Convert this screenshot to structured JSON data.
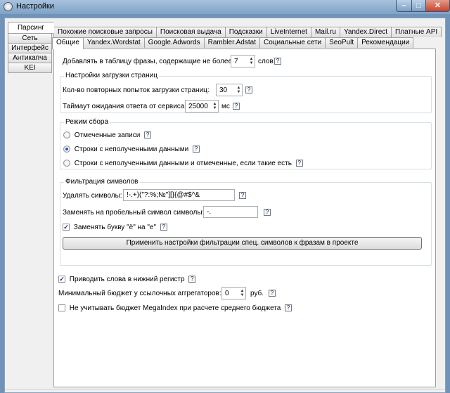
{
  "window": {
    "title": "Настройки",
    "min": "–",
    "max": "□",
    "close": "✕"
  },
  "vtabs": [
    "Парсинг",
    "Сеть",
    "Интерфейс",
    "Антикапча",
    "KEI"
  ],
  "htabs_row1": [
    "Похожие поисковые запросы",
    "Поисковая выдача",
    "Подсказки",
    "LiveInternet",
    "Mail.ru",
    "Yandex.Direct",
    "Платные API"
  ],
  "htabs_row2": [
    "Общие",
    "Yandex.Wordstat",
    "Google.Adwords",
    "Rambler.Adstat",
    "Социальные сети",
    "SeoPult",
    "Рекомендации"
  ],
  "general": {
    "add_phrases_label": "Добавлять в таблицу фразы, содержащие не более",
    "add_phrases_value": "7",
    "add_phrases_unit": "слов",
    "page_load": {
      "title": "Настройки загрузки страниц",
      "retries_label": "Кол-во повторных попыток загрузки страниц:",
      "retries_value": "30",
      "timeout_label": "Таймаут ожидания ответа от сервиса:",
      "timeout_value": "25000",
      "timeout_unit": "мс"
    },
    "mode": {
      "title": "Режим сбора",
      "options": [
        "Отмеченные записи",
        "Строки с неполученными данными",
        "Строки с неполученными данными и отмеченные, если такие есть"
      ],
      "selected": 1
    },
    "filter": {
      "title": "Фильтрация символов",
      "remove_label": "Удалять символы:",
      "remove_value": "!-.+)(\"?:%;№\"][}{@#$^&",
      "replace_label": "Заменять на пробельный символ символы:",
      "replace_value": "-.",
      "yo_label": "Заменять букву \"ё\" на \"е\"",
      "yo_checked": true,
      "apply_button": "Применить настройки фильтрации спец. символов к фразам в проекте"
    },
    "lowercase_label": "Приводить слова в нижний регистр",
    "lowercase_checked": true,
    "min_budget_label": "Минимальный бюджет у ссылочных аггрегаторов:",
    "min_budget_value": "0",
    "min_budget_unit": "руб.",
    "ignore_budget_label": "Не учитывать бюджет MegaIndex при расчете среднего бюджета",
    "ignore_budget_checked": false
  },
  "help_glyph": "?",
  "check_glyph": "✓"
}
